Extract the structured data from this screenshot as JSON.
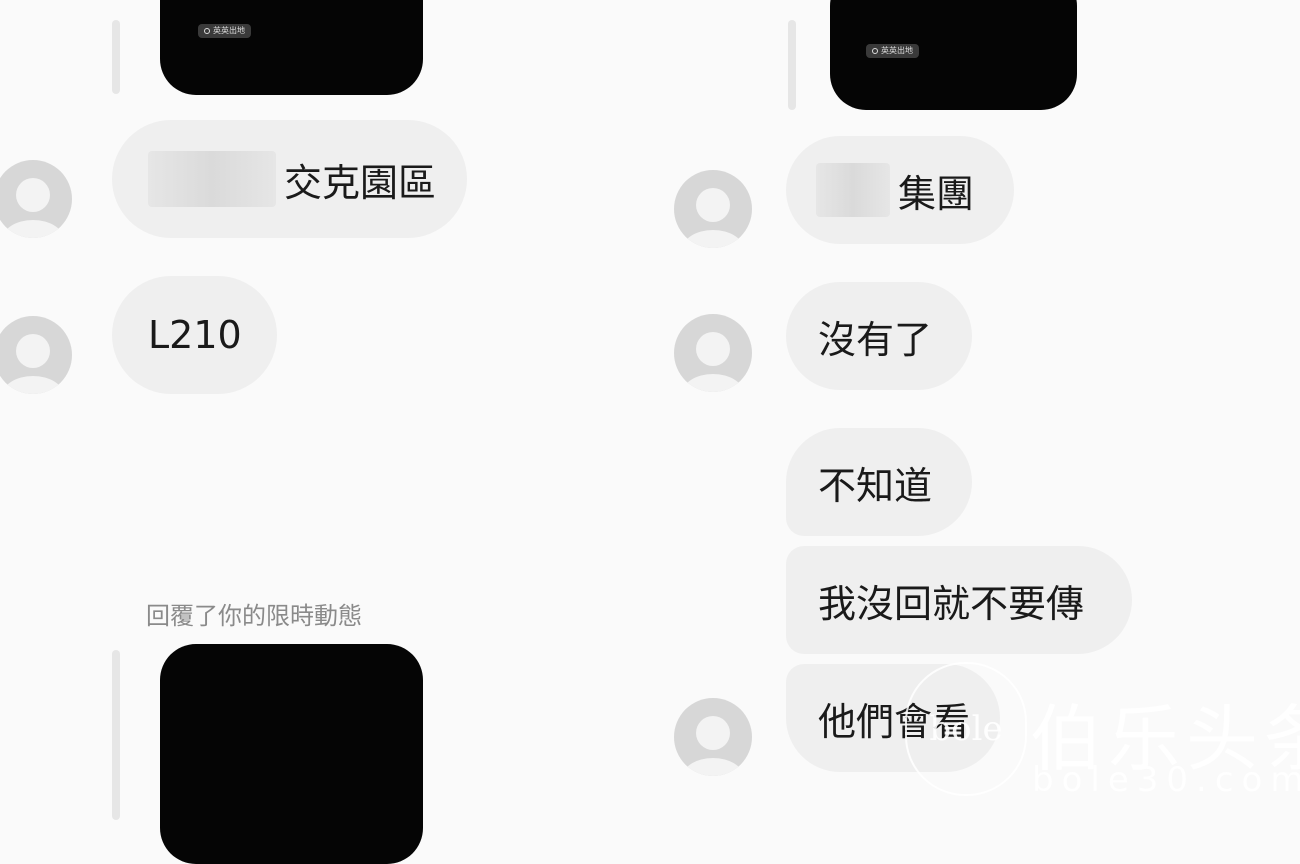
{
  "left": {
    "story_location_top": "英英出地",
    "message_1_visible_suffix": "交克園區",
    "message_2": "L210",
    "story_reply_label": "回覆了你的限時動態"
  },
  "right": {
    "story_location_top": "英英出地",
    "message_1_visible_prefix": "",
    "message_1_visible_suffix": "集團",
    "message_2": "沒有了",
    "message_3": "不知道",
    "message_4": "我沒回就不要傳",
    "message_5": "他們會看"
  },
  "watermark": {
    "logo_text": "bole",
    "site_cn": "伯乐头条",
    "site_url": "bole30.com"
  }
}
